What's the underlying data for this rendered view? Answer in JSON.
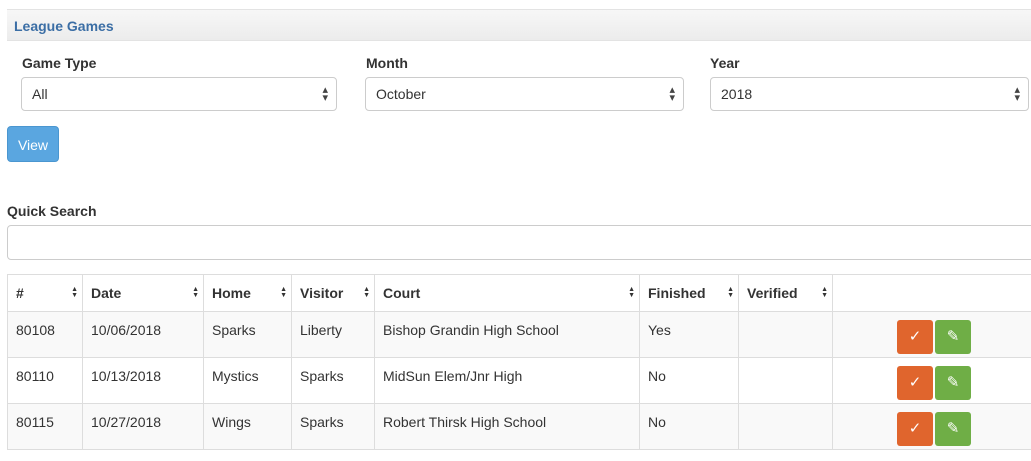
{
  "panel": {
    "title": "League Games"
  },
  "filters": {
    "game_type": {
      "label": "Game Type",
      "value": "All"
    },
    "month": {
      "label": "Month",
      "value": "October"
    },
    "year": {
      "label": "Year",
      "value": "2018"
    }
  },
  "view_button": "View",
  "quick_search": {
    "label": "Quick Search",
    "value": "",
    "placeholder": ""
  },
  "table": {
    "headers": [
      "#",
      "Date",
      "Home",
      "Visitor",
      "Court",
      "Finished",
      "Verified",
      ""
    ],
    "rows": [
      {
        "id": "80108",
        "date": "10/06/2018",
        "home": "Sparks",
        "visitor": "Liberty",
        "court": "Bishop Grandin High School",
        "finished": "Yes",
        "verified": ""
      },
      {
        "id": "80110",
        "date": "10/13/2018",
        "home": "Mystics",
        "visitor": "Sparks",
        "court": "MidSun Elem/Jnr High",
        "finished": "No",
        "verified": ""
      },
      {
        "id": "80115",
        "date": "10/27/2018",
        "home": "Wings",
        "visitor": "Sparks",
        "court": "Robert Thirsk High School",
        "finished": "No",
        "verified": ""
      }
    ]
  },
  "icons": {
    "verify": "check-circle-icon",
    "edit": "pencil-icon"
  },
  "colors": {
    "title": "#3b6ea5",
    "view_button": "#5aa6e0",
    "verify_button": "#e0652d",
    "edit_button": "#6fae46"
  }
}
